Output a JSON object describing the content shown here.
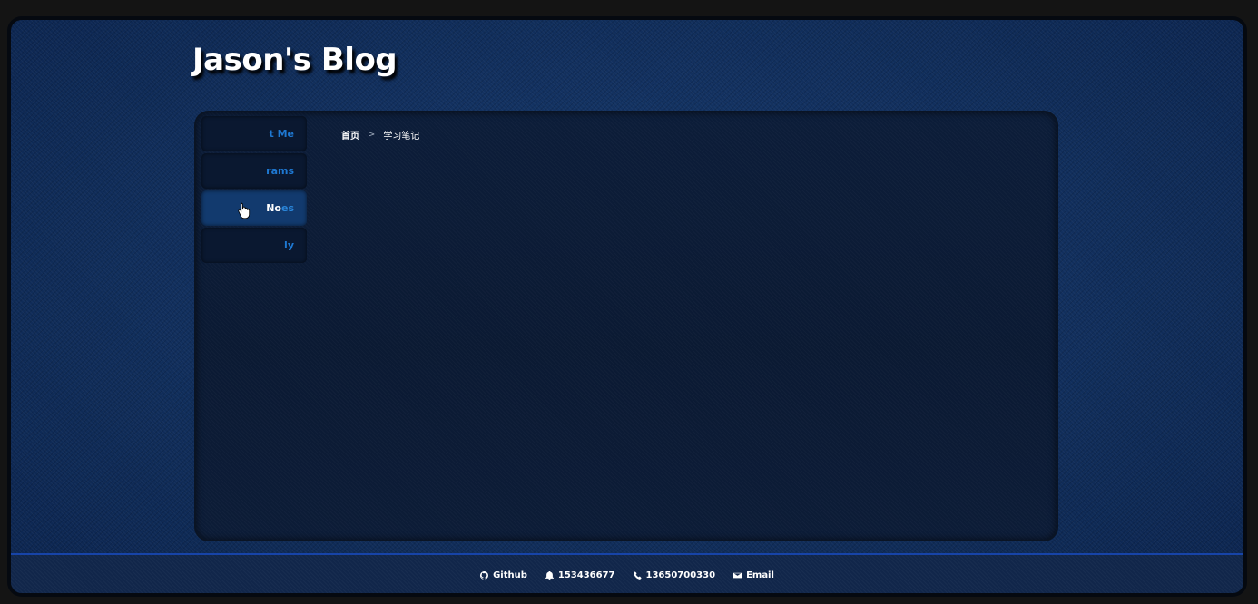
{
  "header": {
    "title": "Jason's Blog"
  },
  "nav": {
    "items": [
      {
        "label": "t Me"
      },
      {
        "label": "rams"
      },
      {
        "label_strong": "No",
        "label_rest": "es",
        "active": true
      },
      {
        "label": "ly"
      }
    ]
  },
  "breadcrumb": {
    "home": "首页",
    "separator": ">",
    "current": "学习笔记"
  },
  "footer": {
    "github": {
      "icon": "github-icon",
      "label": "Github"
    },
    "qq": {
      "icon": "bell-icon",
      "label": "153436677"
    },
    "phone": {
      "icon": "phone-icon",
      "label": "13650700330"
    },
    "email": {
      "icon": "mail-icon",
      "label": "Email"
    }
  },
  "colors": {
    "background": "#143565",
    "panel": "#0c1c37",
    "nav_text": "#1e78d2",
    "nav_active": "#123a6e",
    "footer_border": "#1744a8"
  }
}
